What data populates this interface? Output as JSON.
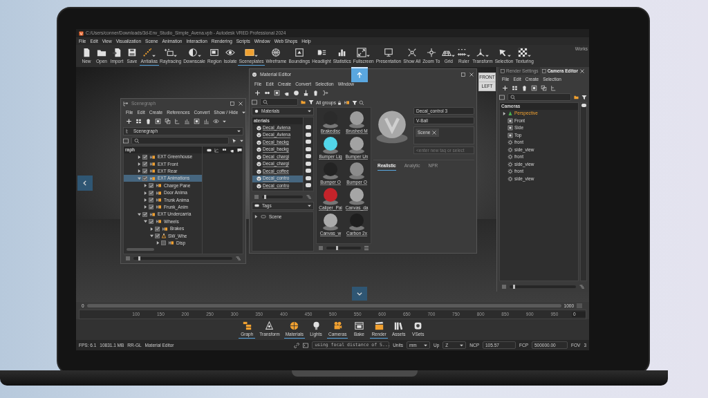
{
  "window": {
    "title": "C:/Users/conner/Downloads/3d-Env_Studio_Simple_Avena.vpb - Autodesk VRED Professional 2024"
  },
  "menu": [
    "File",
    "Edit",
    "View",
    "Visualization",
    "Scene",
    "Animation",
    "Interaction",
    "Rendering",
    "Scripts",
    "Window",
    "Web Shops",
    "Help"
  ],
  "toolbar": [
    {
      "label": "New",
      "active": false,
      "dropdown": false
    },
    {
      "label": "Open",
      "active": false,
      "dropdown": false
    },
    {
      "label": "Import",
      "active": false,
      "dropdown": false
    },
    {
      "label": "Save",
      "active": false,
      "dropdown": false
    },
    {
      "label": "Antialias",
      "active": true,
      "dropdown": true
    },
    {
      "label": "Raytracing",
      "active": false,
      "dropdown": true
    },
    {
      "label": "Downscale",
      "active": false,
      "dropdown": true
    },
    {
      "label": "Region",
      "active": false,
      "dropdown": false
    },
    {
      "label": "Isolate",
      "active": false,
      "dropdown": false
    },
    {
      "label": "Sceneplates",
      "active": true,
      "dropdown": true
    },
    {
      "label": "Wireframe",
      "active": false,
      "dropdown": false
    },
    {
      "label": "Boundings",
      "active": false,
      "dropdown": false
    },
    {
      "label": "Headlight",
      "active": false,
      "dropdown": false
    },
    {
      "label": "Statistics",
      "active": false,
      "dropdown": false
    },
    {
      "label": "Fullscreen",
      "active": false,
      "dropdown": true
    },
    {
      "label": "Presentation",
      "active": false,
      "dropdown": false
    },
    {
      "label": "Show All",
      "active": false,
      "dropdown": false
    },
    {
      "label": "Zoom To",
      "active": false,
      "dropdown": false
    },
    {
      "label": "Grid",
      "active": false,
      "dropdown": true
    },
    {
      "label": "Ruler",
      "active": false,
      "dropdown": true
    },
    {
      "label": "Transform",
      "active": false,
      "dropdown": true
    },
    {
      "label": "Selection",
      "active": false,
      "dropdown": true
    },
    {
      "label": "Texturing",
      "active": false,
      "dropdown": true
    }
  ],
  "workspace": "Works",
  "nav_cube": [
    "FRONT",
    "LEFT"
  ],
  "scenegraph": {
    "title": "Scenegraph",
    "zoom": {
      "level": 0.05
    },
    "menu": [
      "File",
      "Edit",
      "Create",
      "References",
      "Convert",
      "Show / Hide"
    ],
    "path": "Scenegraph",
    "column": "raph",
    "tree": [
      {
        "label": "EXT Greenhouse",
        "kind": "group",
        "checked": true,
        "expanded": false,
        "selected": false
      },
      {
        "label": "EXT Front",
        "kind": "group",
        "checked": true,
        "expanded": false,
        "selected": false
      },
      {
        "label": "EXT Rear",
        "kind": "group",
        "checked": true,
        "expanded": false,
        "selected": false
      },
      {
        "label": "EXT Animations",
        "kind": "group",
        "checked": true,
        "expanded": true,
        "selected": true,
        "children": [
          {
            "label": "Charge Pane",
            "kind": "group",
            "checked": true,
            "expanded": false,
            "selected": false
          },
          {
            "label": "Door Anima",
            "kind": "group",
            "checked": true,
            "expanded": false,
            "selected": false
          },
          {
            "label": "Trunk Anima",
            "kind": "group",
            "checked": true,
            "expanded": false,
            "selected": false
          },
          {
            "label": "Frunk_Anim",
            "kind": "group",
            "checked": true,
            "expanded": false,
            "selected": false
          }
        ]
      },
      {
        "label": "EXT Undercarria",
        "kind": "group",
        "checked": true,
        "expanded": true,
        "selected": false,
        "children": [
          {
            "label": "Wheels",
            "kind": "group",
            "checked": true,
            "expanded": true,
            "selected": false,
            "children": [
              {
                "label": "Brakes",
                "kind": "group",
                "checked": true,
                "expanded": false,
                "selected": false
              },
              {
                "label": "SW_Whe",
                "kind": "transform",
                "checked": true,
                "expanded": true,
                "selected": false,
                "children": [
                  {
                    "label": "Disp",
                    "kind": "group",
                    "checked": false,
                    "expanded": false,
                    "selected": false
                  }
                ]
              }
            ]
          }
        ]
      }
    ]
  },
  "material_editor": {
    "title": "Material Editor",
    "list_zoom": {
      "level": 0.05
    },
    "thumb_zoom": {
      "level": 0.3
    },
    "menu": [
      "File",
      "Edit",
      "Create",
      "Convert",
      "Selection",
      "Window"
    ],
    "library": "Materials",
    "list_header": "aterials",
    "materials": [
      {
        "label": "Decal_Aviena",
        "selected": false
      },
      {
        "label": "Decal_Aviena",
        "selected": false
      },
      {
        "label": "Decal_backg",
        "selected": false
      },
      {
        "label": "Decal_backg",
        "selected": false
      },
      {
        "label": "Decal_chargi",
        "selected": false
      },
      {
        "label": "Decal_chargi",
        "selected": false
      },
      {
        "label": "Decal_coffee",
        "selected": false
      },
      {
        "label": "Decal_contro",
        "selected": true
      },
      {
        "label": "Decal_contro",
        "selected": false
      }
    ],
    "tags_dropdown": "Tags",
    "tags_tree": [
      {
        "label": "Scene",
        "expanded": false
      }
    ],
    "groups": "All groups",
    "thumbnails": [
      {
        "label": "Brakedisc",
        "color": "#2b2b2b"
      },
      {
        "label": "Brushed M",
        "color": "#9c9c9c"
      },
      {
        "label": "Bumper Lig",
        "color": "#52d6ea"
      },
      {
        "label": "Bumper Un",
        "color": "#a3a3a3"
      },
      {
        "label": "Bumper O",
        "color": "#232323"
      },
      {
        "label": "Bumper O",
        "color": "#8c8c8c"
      },
      {
        "label": "Caliper_Pai",
        "color": "#c4232a"
      },
      {
        "label": "Canvas_da",
        "color": "#a6a6a6"
      },
      {
        "label": "Canvas_w",
        "color": "#aaaaaa"
      },
      {
        "label": "Carbon 2x",
        "color": "#1e1e1e"
      }
    ],
    "name": "Decal_control 3",
    "geometry": "V-Ball",
    "tags": [
      "Scene"
    ],
    "tag_placeholder": "<enter new tag or select",
    "tabs": [
      {
        "label": "Realistic",
        "selected": true
      },
      {
        "label": "Analytic",
        "selected": false
      },
      {
        "label": "NPR",
        "selected": false
      }
    ]
  },
  "camera_editor": {
    "zoom": {
      "level": 0.05
    },
    "tabs": [
      {
        "label": "Render Settings",
        "selected": false
      },
      {
        "label": "Camera Editor",
        "selected": true
      }
    ],
    "menu": [
      "File",
      "Edit",
      "Create",
      "Selection"
    ],
    "header": "Cameras",
    "cameras": [
      {
        "label": "Perspective",
        "kind": "perspective",
        "active": true,
        "expandable": true
      },
      {
        "label": "Front",
        "kind": "view",
        "active": false,
        "expandable": false
      },
      {
        "label": "Side",
        "kind": "view",
        "active": false,
        "expandable": false
      },
      {
        "label": "Top",
        "kind": "view",
        "active": false,
        "expandable": false
      },
      {
        "label": "front",
        "kind": "viewpoint",
        "active": false,
        "expandable": false
      },
      {
        "label": "side_view",
        "kind": "viewpoint",
        "active": false,
        "expandable": false
      },
      {
        "label": "front",
        "kind": "viewpoint",
        "active": false,
        "expandable": false
      },
      {
        "label": "side_view",
        "kind": "viewpoint",
        "active": false,
        "expandable": false
      },
      {
        "label": "front",
        "kind": "viewpoint",
        "active": false,
        "expandable": false
      },
      {
        "label": "side_view",
        "kind": "viewpoint",
        "active": false,
        "expandable": false
      }
    ]
  },
  "timeline": {
    "start": "0",
    "end": "1000",
    "range": {
      "level": 1
    },
    "ticks": [
      "100",
      "150",
      "200",
      "250",
      "300",
      "350",
      "400",
      "450",
      "500",
      "550",
      "600",
      "650",
      "700",
      "750",
      "800",
      "850",
      "900",
      "950"
    ],
    "current": "0"
  },
  "modules": [
    {
      "label": "Graph",
      "active": true
    },
    {
      "label": "Transform",
      "active": false
    },
    {
      "label": "Materials",
      "active": true
    },
    {
      "label": "Lights",
      "active": false
    },
    {
      "label": "Cameras",
      "active": true
    },
    {
      "label": "Bake",
      "active": false
    },
    {
      "label": "Render",
      "active": true
    },
    {
      "label": "Assets",
      "active": false
    },
    {
      "label": "VSets",
      "active": false
    }
  ],
  "status_bar": {
    "fps": "FPS: 6.1",
    "memory": "10831.1 MB",
    "renderer": "RR-GL",
    "module": "Material Editor",
    "message": "using focal distance of S...",
    "units_label": "Units",
    "units": "mm",
    "up_label": "Up",
    "up": "Z",
    "ncp_label": "NCP",
    "ncp": "105.57",
    "fcp_label": "FCP",
    "fcp": "500000.00",
    "fov_label": "FOV",
    "fov": "3"
  }
}
